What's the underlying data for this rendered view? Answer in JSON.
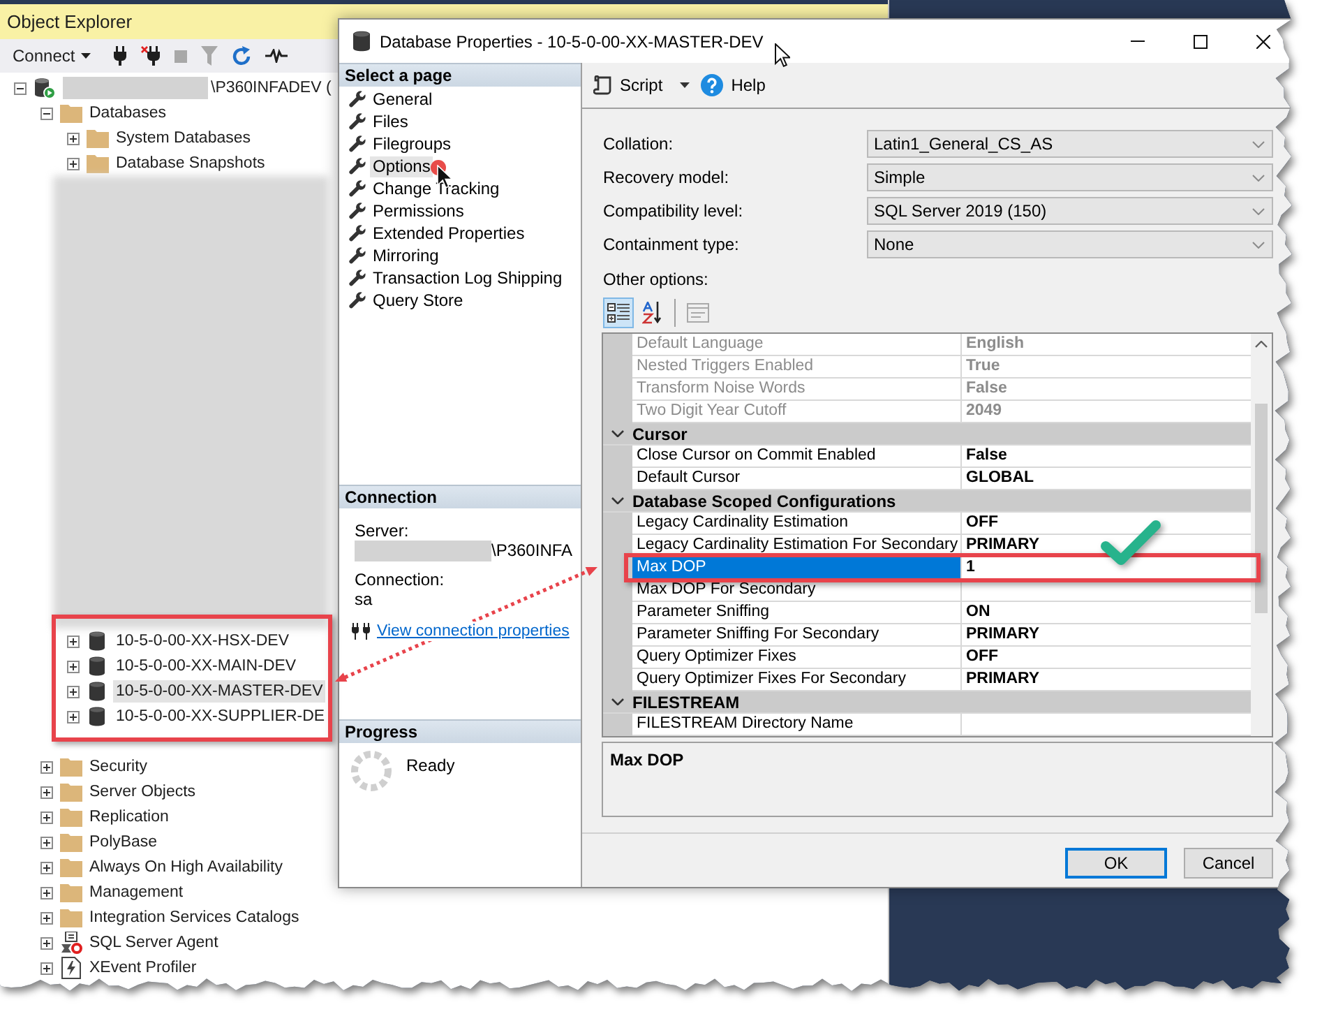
{
  "object_explorer": {
    "title": "Object Explorer",
    "toolbar": {
      "connect": "Connect",
      "buttons": [
        {
          "kind": "connect",
          "disabled": false
        },
        {
          "kind": "disconnect",
          "disabled": false
        },
        {
          "kind": "stop",
          "disabled": true
        },
        {
          "kind": "filter",
          "disabled": true
        },
        {
          "kind": "refresh",
          "disabled": false
        },
        {
          "kind": "activity",
          "disabled": false
        }
      ]
    },
    "tree": [
      {
        "kind": "server",
        "label": "\\P360INFADEV (",
        "redacted": true,
        "expanded": true,
        "selected": false,
        "children": [
          {
            "kind": "folder",
            "label": "Databases",
            "expanded": true,
            "selected": false,
            "children": [
              {
                "kind": "folder",
                "label": "System Databases",
                "expanded": false,
                "selected": false
              },
              {
                "kind": "folder",
                "label": "Database Snapshots",
                "expanded": false,
                "selected": false
              },
              {
                "kind": "redacted"
              },
              {
                "kind": "database",
                "label": "10-5-0-00-XX-HSX-DEV",
                "expanded": false,
                "selected": false
              },
              {
                "kind": "database",
                "label": "10-5-0-00-XX-MAIN-DEV",
                "expanded": false,
                "selected": false
              },
              {
                "kind": "database",
                "label": "10-5-0-00-XX-MASTER-DEV",
                "expanded": false,
                "selected": true
              },
              {
                "kind": "database",
                "label": "10-5-0-00-XX-SUPPLIER-DE",
                "expanded": false,
                "selected": false
              }
            ]
          },
          {
            "kind": "folder",
            "label": "Security",
            "expanded": false,
            "selected": false
          },
          {
            "kind": "folder",
            "label": "Server Objects",
            "expanded": false,
            "selected": false
          },
          {
            "kind": "folder",
            "label": "Replication",
            "expanded": false,
            "selected": false
          },
          {
            "kind": "folder",
            "label": "PolyBase",
            "expanded": false,
            "selected": false
          },
          {
            "kind": "folder",
            "label": "Always On High Availability",
            "expanded": false,
            "selected": false
          },
          {
            "kind": "folder",
            "label": "Management",
            "expanded": false,
            "selected": false
          },
          {
            "kind": "folder",
            "label": "Integration Services Catalogs",
            "expanded": false,
            "selected": false
          },
          {
            "kind": "agent",
            "label": "SQL Server Agent",
            "expanded": false,
            "selected": false
          },
          {
            "kind": "profiler",
            "label": "XEvent Profiler",
            "expanded": false,
            "selected": false
          }
        ]
      }
    ]
  },
  "dialog": {
    "title": "Database Properties - 10-5-0-00-XX-MASTER-DEV",
    "pages_header": "Select a page",
    "pages": [
      {
        "label": "General",
        "selected": false
      },
      {
        "label": "Files",
        "selected": false
      },
      {
        "label": "Filegroups",
        "selected": false
      },
      {
        "label": "Options",
        "selected": true
      },
      {
        "label": "Change Tracking",
        "selected": false
      },
      {
        "label": "Permissions",
        "selected": false
      },
      {
        "label": "Extended Properties",
        "selected": false
      },
      {
        "label": "Mirroring",
        "selected": false
      },
      {
        "label": "Transaction Log Shipping",
        "selected": false
      },
      {
        "label": "Query Store",
        "selected": false
      }
    ],
    "connection": {
      "header": "Connection",
      "server_label": "Server:",
      "server_value": "\\P360INFA",
      "server_redacted": true,
      "connection_label": "Connection:",
      "connection_value": "sa",
      "link": "View connection properties"
    },
    "progress": {
      "header": "Progress",
      "status": "Ready"
    },
    "toolbar": {
      "script": "Script",
      "help": "Help"
    },
    "fields": [
      {
        "label": "Collation:",
        "value": "Latin1_General_CS_AS"
      },
      {
        "label": "Recovery model:",
        "value": "Simple"
      },
      {
        "label": "Compatibility level:",
        "value": "SQL Server 2019 (150)"
      },
      {
        "label": "Containment type:",
        "value": "None"
      }
    ],
    "other_options_label": "Other options:",
    "grid_toolbar": [
      {
        "kind": "categorized",
        "selected": true,
        "disabled": false
      },
      {
        "kind": "alphabetical",
        "selected": false,
        "disabled": false
      },
      {
        "kind": "property_pages",
        "selected": false,
        "disabled": true
      }
    ],
    "grid_rows": [
      {
        "kind": "property",
        "name": "Default Language",
        "value": "English",
        "readonly": true,
        "selected": false
      },
      {
        "kind": "property",
        "name": "Nested Triggers Enabled",
        "value": "True",
        "readonly": true,
        "selected": false
      },
      {
        "kind": "property",
        "name": "Transform Noise Words",
        "value": "False",
        "readonly": true,
        "selected": false
      },
      {
        "kind": "property",
        "name": "Two Digit Year Cutoff",
        "value": "2049",
        "readonly": true,
        "selected": false
      },
      {
        "kind": "category",
        "label": "Cursor",
        "expanded": true
      },
      {
        "kind": "property",
        "name": "Close Cursor on Commit Enabled",
        "value": "False",
        "readonly": false,
        "selected": false
      },
      {
        "kind": "property",
        "name": "Default Cursor",
        "value": "GLOBAL",
        "readonly": false,
        "selected": false
      },
      {
        "kind": "category",
        "label": "Database Scoped Configurations",
        "expanded": true
      },
      {
        "kind": "property",
        "name": "Legacy Cardinality Estimation",
        "value": "OFF",
        "readonly": false,
        "selected": false
      },
      {
        "kind": "property",
        "name": "Legacy Cardinality Estimation For Secondary",
        "value": "PRIMARY",
        "readonly": false,
        "selected": false
      },
      {
        "kind": "property",
        "name": "Max DOP",
        "value": "1",
        "readonly": false,
        "selected": true
      },
      {
        "kind": "property",
        "name": "Max DOP For Secondary",
        "readonly": false,
        "selected": false
      },
      {
        "kind": "property",
        "name": "Parameter Sniffing",
        "value": "ON",
        "readonly": false,
        "selected": false
      },
      {
        "kind": "property",
        "name": "Parameter Sniffing For Secondary",
        "value": "PRIMARY",
        "readonly": false,
        "selected": false
      },
      {
        "kind": "property",
        "name": "Query Optimizer Fixes",
        "value": "OFF",
        "readonly": false,
        "selected": false
      },
      {
        "kind": "property",
        "name": "Query Optimizer Fixes For Secondary",
        "value": "PRIMARY",
        "readonly": false,
        "selected": false
      },
      {
        "kind": "category",
        "label": "FILESTREAM",
        "expanded": true
      },
      {
        "kind": "property",
        "name": "FILESTREAM Directory Name",
        "readonly": false,
        "selected": false
      }
    ],
    "description": "Max DOP",
    "buttons": [
      {
        "label": "OK",
        "default": true
      },
      {
        "label": "Cancel",
        "default": false
      }
    ]
  }
}
